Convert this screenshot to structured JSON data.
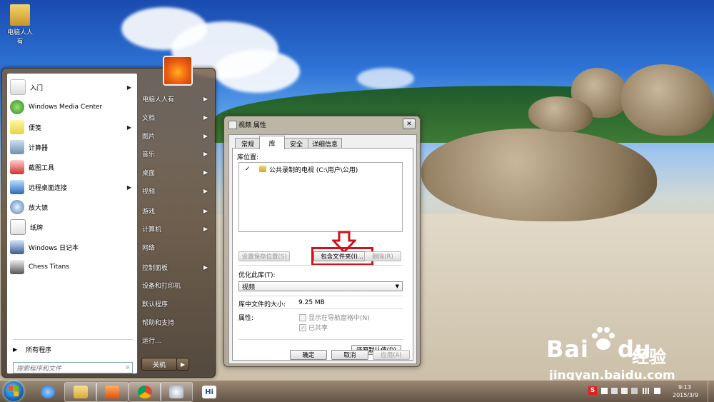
{
  "desktop": {
    "icon_label": "电脑人人有"
  },
  "start_menu": {
    "left_items": [
      {
        "label": "入门",
        "arrow": true
      },
      {
        "label": "Windows Media Center",
        "arrow": false
      },
      {
        "label": "便笺",
        "arrow": true
      },
      {
        "label": "计算器",
        "arrow": false
      },
      {
        "label": "截图工具",
        "arrow": false
      },
      {
        "label": "远程桌面连接",
        "arrow": true
      },
      {
        "label": "放大镜",
        "arrow": false
      },
      {
        "label": "纸牌",
        "arrow": false
      },
      {
        "label": "Windows 日记本",
        "arrow": false
      },
      {
        "label": "Chess Titans",
        "arrow": false
      }
    ],
    "all_programs": "所有程序",
    "search_placeholder": "搜索程序和文件",
    "right_items": [
      {
        "label": "电脑人人有",
        "arrow": true
      },
      {
        "label": "文档",
        "arrow": true
      },
      {
        "label": "图片",
        "arrow": true
      },
      {
        "label": "音乐",
        "arrow": true
      },
      {
        "label": "桌面",
        "arrow": true
      },
      {
        "label": "视频",
        "arrow": true
      },
      {
        "label": "游戏",
        "arrow": true
      },
      {
        "label": "计算机",
        "arrow": true
      },
      {
        "label": "网络",
        "arrow": false
      },
      {
        "label": "控制面板",
        "arrow": true
      },
      {
        "label": "设备和打印机",
        "arrow": false
      },
      {
        "label": "默认程序",
        "arrow": false
      },
      {
        "label": "帮助和支持",
        "arrow": false
      },
      {
        "label": "运行...",
        "arrow": false
      }
    ],
    "shutdown_label": "关机",
    "shutdown_arrow": "▶"
  },
  "dialog": {
    "title": "视频 属性",
    "close": "✕",
    "tabs": [
      "常规",
      "库",
      "安全",
      "详细信息"
    ],
    "library_locations_label": "库位置:",
    "location_check": "✓",
    "location_entry": "公共录制的电视 (C:\\用户\\公用)",
    "btn_set_save": "设置保存位置(S)",
    "btn_include": "包含文件夹(I)...",
    "btn_remove": "删除(R)",
    "optimize_label": "优化此库(T):",
    "optimize_value": "视频",
    "size_label": "库中文件的大小:",
    "size_value": "9.25 MB",
    "attributes_label": "属性:",
    "attr_show_nav": "显示在导航窗格中(N)",
    "attr_shared": "已共享",
    "shared_check": "✓",
    "btn_restore": "还原默认值(D)",
    "btn_ok": "确定",
    "btn_cancel": "取消",
    "btn_apply": "应用(A)",
    "highlight_color": "#d0121b"
  },
  "taskbar": {
    "time": "9:13",
    "date": "2015/3/9",
    "hi_label": "Hi"
  },
  "watermark": {
    "brand": "Bai",
    "brand2": "du",
    "sub": "经验",
    "url": "jingyan.baidu.com"
  }
}
